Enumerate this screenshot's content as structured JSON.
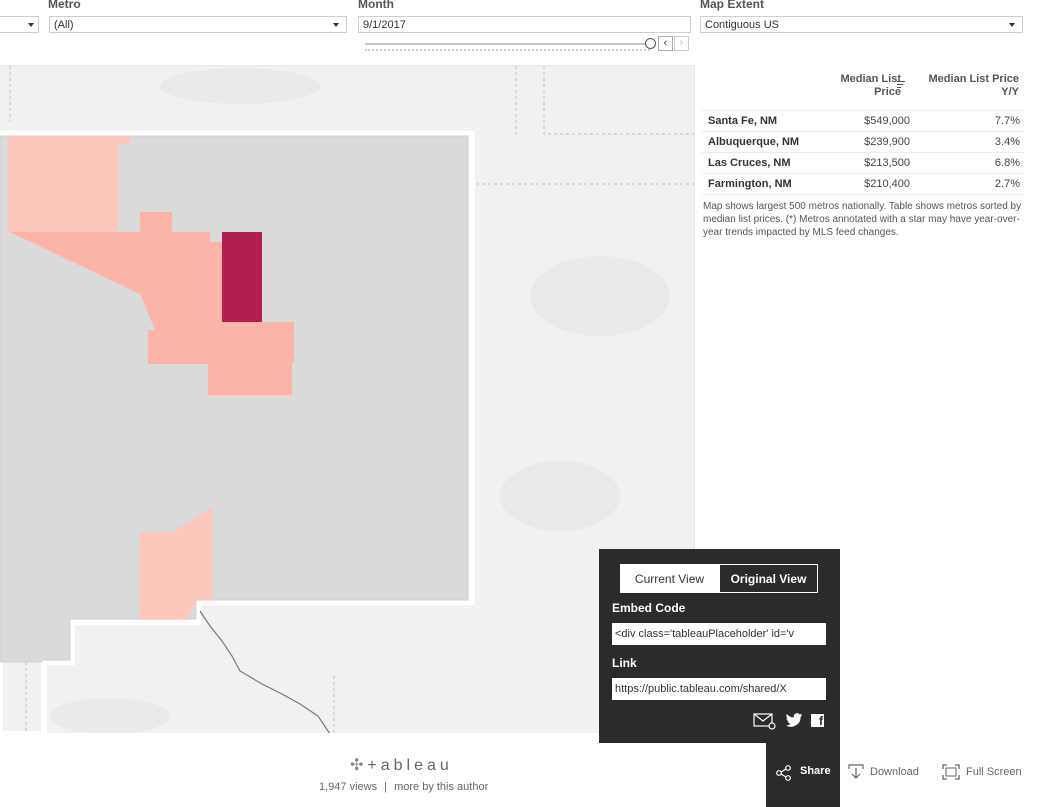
{
  "filters": {
    "metro": {
      "label": "Metro",
      "value": "(All)"
    },
    "month": {
      "label": "Month",
      "value": "9/1/2017"
    },
    "extent": {
      "label": "Map Extent",
      "value": "Contiguous US"
    }
  },
  "table": {
    "headers": {
      "price": "Median List\nPrice",
      "yy": "Median List Price\nY/Y"
    },
    "rows": [
      {
        "name": "Santa Fe, NM",
        "price": "$549,000",
        "yy": "7.7%"
      },
      {
        "name": "Albuquerque, NM",
        "price": "$239,900",
        "yy": "3.4%"
      },
      {
        "name": "Las Cruces, NM",
        "price": "$213,500",
        "yy": "6.8%"
      },
      {
        "name": "Farmington, NM",
        "price": "$210,400",
        "yy": "2.7%"
      }
    ],
    "note": "Map shows largest 500 metros nationally. Table shows metros sorted by median list prices. (*) Metros annotated with a star may have year-over-year trends impacted by MLS feed changes."
  },
  "colors": {
    "high": "#b01f4f",
    "mid": "#fbb5a8",
    "low": "#fdc8bc",
    "state": "#dadada",
    "bg": "#f1f1f1"
  },
  "footer": {
    "logo": "+ableau",
    "views": "1,947 views",
    "separator": "|",
    "author_link": "more by this author"
  },
  "share": {
    "tabs": [
      "Current View",
      "Original View"
    ],
    "active_tab": "Original View",
    "embed_label": "Embed Code",
    "embed_value": "<div class='tableauPlaceholder' id='v",
    "link_label": "Link",
    "link_value": "https://public.tableau.com/shared/X",
    "icons": [
      "email-link-icon",
      "twitter-icon",
      "facebook-icon"
    ]
  },
  "toolbar": {
    "share": "Share",
    "download": "Download",
    "fullscreen": "Full Screen"
  }
}
